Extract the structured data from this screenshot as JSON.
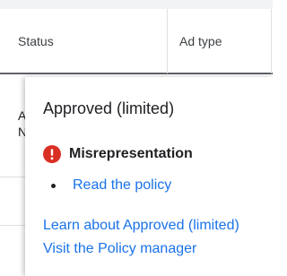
{
  "table": {
    "header": {
      "status_label": "Status",
      "ad_type_label": "Ad type"
    },
    "peek_row": {
      "line1": "A",
      "line2": "N"
    }
  },
  "popover": {
    "title": "Approved (limited)",
    "issue": {
      "icon": "error-icon",
      "label": "Misrepresentation"
    },
    "policy_link": "Read the policy",
    "learn_link": "Learn about Approved (limited)",
    "manager_link": "Visit the Policy manager"
  },
  "colors": {
    "link": "#1a73e8",
    "error": "#d93025",
    "text": "#202124"
  }
}
